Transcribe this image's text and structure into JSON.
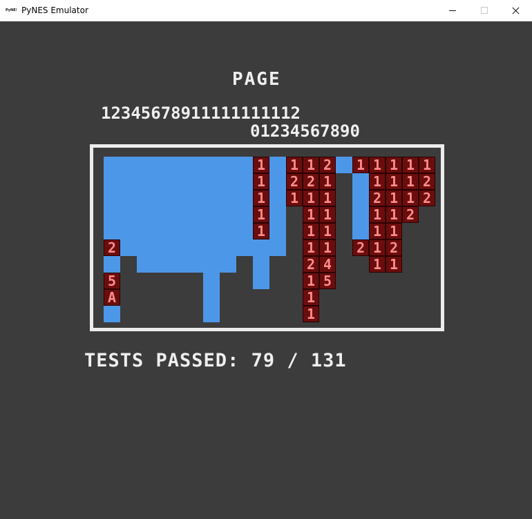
{
  "window": {
    "title": "PyNES Emulator",
    "icon": "PyNES",
    "buttons": [
      "minimize",
      "maximize",
      "close"
    ]
  },
  "screen": {
    "heading": "PAGE",
    "page_digits_row1": "12345678911111111112",
    "page_digits_row2": "01234567890",
    "summary": "TESTS PASSED: 79 / 131"
  },
  "colors": {
    "pass": "#4d97e8",
    "fail_bg": "#6b0d0d",
    "fail_text": "#ff8d8d",
    "frame": "#ececec",
    "screen_bg": "#3c3c3c"
  },
  "grid": {
    "columns": 20,
    "rows": 10,
    "cells": [
      "PPPPPPPPP1P112P11111",
      "PPPPPPPPP1P221.P1112",
      "PPPPPPPPP1P111.P2112",
      "PPPPPPPPP1P.11.P112.",
      "PPPPPPPPP1P.11.P11..",
      "2PPPPPPPPPP.11.212..",
      "P.PPPPPP.P..24..11..",
      "5.....P..P..15......",
      "A.....P.....1.......",
      "P.....P.....1......."
    ]
  }
}
